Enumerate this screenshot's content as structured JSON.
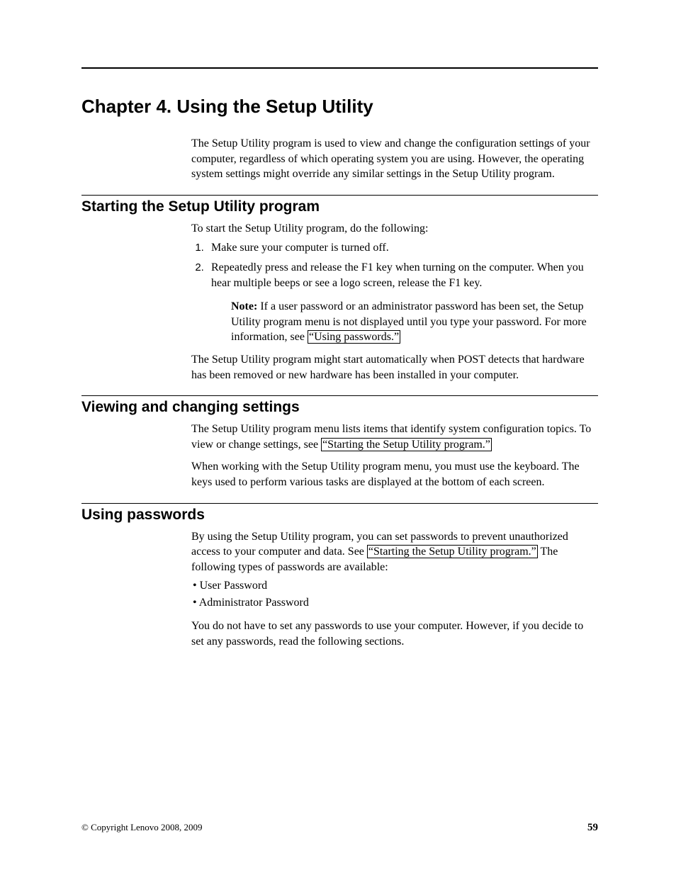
{
  "chapter": {
    "title": "Chapter 4. Using the Setup Utility",
    "intro": "The Setup Utility program is used to view and change the configuration settings of your computer, regardless of which operating system you are using. However, the operating system settings might override any similar settings in the Setup Utility program."
  },
  "sections": {
    "starting": {
      "title": "Starting the Setup Utility program",
      "lead": "To start the Setup Utility program, do the following:",
      "step1": "Make sure your computer is turned off.",
      "step2": "Repeatedly press and release the F1 key when turning on the computer. When you hear multiple beeps or see a logo screen, release the F1 key.",
      "note_label": "Note:",
      "note_text_a": " If a user password or an administrator password has been set, the Setup Utility program menu is not displayed until you type your password. For more information, see ",
      "note_link": "“Using passwords.”",
      "after": "The Setup Utility program might start automatically when POST detects that hardware has been removed or new hardware has been installed in your computer."
    },
    "viewing": {
      "title": "Viewing and changing settings",
      "p1_a": "The Setup Utility program menu lists items that identify system configuration topics. To view or change settings, see ",
      "p1_link": "“Starting the Setup Utility program.”",
      "p2": "When working with the Setup Utility program menu, you must use the keyboard. The keys used to perform various tasks are displayed at the bottom of each screen."
    },
    "passwords": {
      "title": "Using passwords",
      "p1_a": "By using the Setup Utility program, you can set passwords to prevent unauthorized access to your computer and data. See ",
      "p1_link": "“Starting the Setup Utility program.”",
      "p1_b": " The following types of passwords are available:",
      "bullet1": "User Password",
      "bullet2": "Administrator Password",
      "p2": "You do not have to set any passwords to use your computer. However, if you decide to set any passwords, read the following sections."
    }
  },
  "footer": {
    "copyright": "© Copyright Lenovo 2008, 2009",
    "page": "59"
  }
}
